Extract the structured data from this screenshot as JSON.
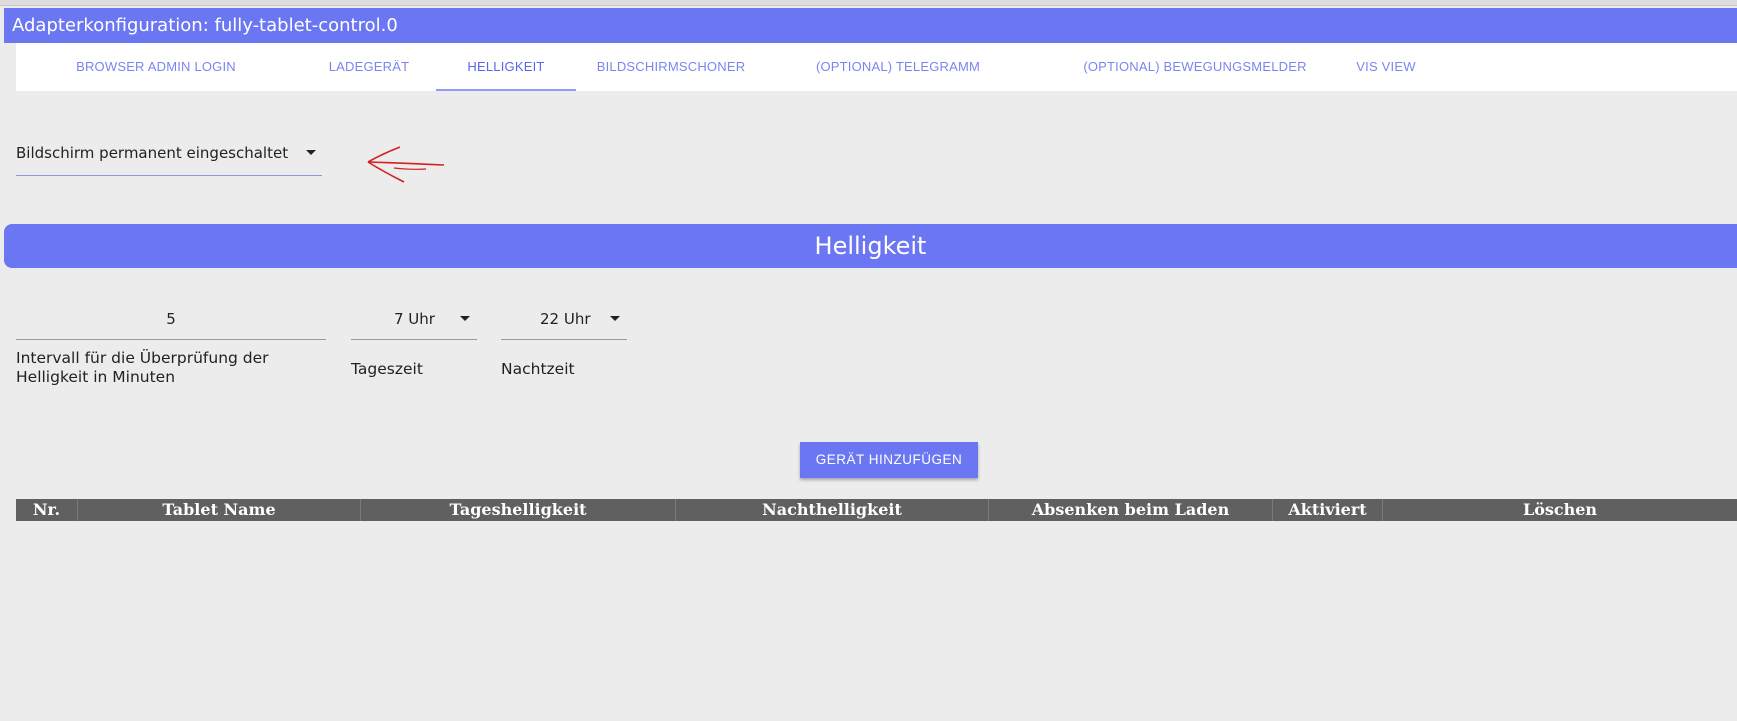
{
  "window": {
    "title": "Adapterkonfiguration: fully-tablet-control.0"
  },
  "tabs": [
    {
      "label": "Browser Admin Login"
    },
    {
      "label": "Ladegerät"
    },
    {
      "label": "Helligkeit",
      "active": true
    },
    {
      "label": "Bildschirmschoner"
    },
    {
      "label": "(Optional) Telegramm"
    },
    {
      "label": "(Optional) Bewegungsmelder"
    },
    {
      "label": "VIS View"
    }
  ],
  "screen_mode_select": {
    "value": "Bildschirm permanent eingeschaltet"
  },
  "section": {
    "title": "Helligkeit"
  },
  "fields": {
    "interval": {
      "value": "5",
      "label": "Intervall für die Überprüfung der Helligkeit in Minuten"
    },
    "daytime": {
      "value": "7 Uhr",
      "label": "Tageszeit"
    },
    "nighttime": {
      "value": "22 Uhr",
      "label": "Nachtzeit"
    }
  },
  "add_device_button": {
    "label": "Gerät hinzufügen"
  },
  "table": {
    "headers": [
      "Nr.",
      "Tablet Name",
      "Tageshelligkeit",
      "Nachthelligkeit",
      "Absenken beim Laden",
      "Aktiviert",
      "Löschen"
    ]
  },
  "colors": {
    "accent": "#6b76f3",
    "tab_text": "#7a86f0",
    "table_header_bg": "#606060",
    "annotation_arrow": "#d32020"
  },
  "icons": {
    "dropdown": "caret-down-icon",
    "annotation": "red-arrow-annotation"
  }
}
